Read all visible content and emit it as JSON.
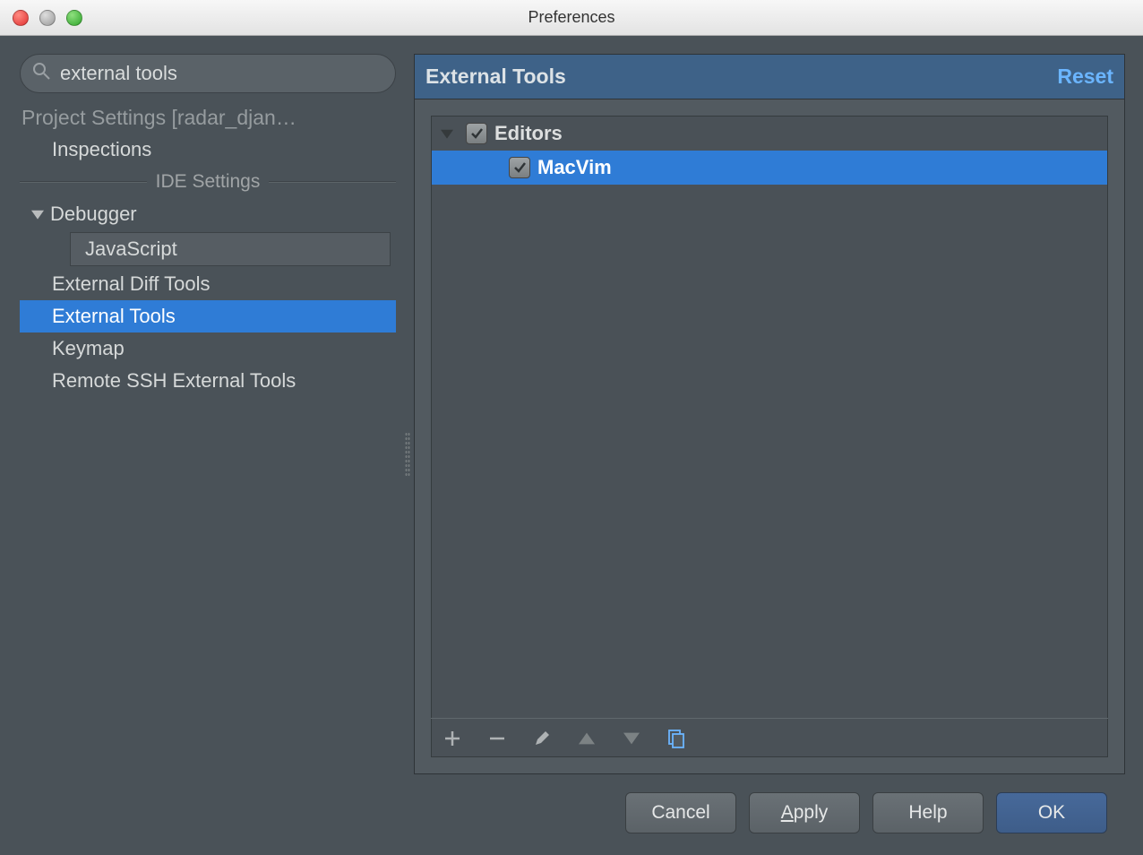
{
  "window": {
    "title": "Preferences"
  },
  "search": {
    "value": "external tools"
  },
  "sidebar": {
    "project_heading": "Project Settings [radar_djan…",
    "items": {
      "inspections": "Inspections",
      "ide_divider": "IDE Settings",
      "debugger": "Debugger",
      "javascript": "JavaScript",
      "ext_diff": "External Diff Tools",
      "ext_tools": "External Tools",
      "keymap": "Keymap",
      "remote_ssh": "Remote SSH External Tools"
    }
  },
  "panel": {
    "title": "External Tools",
    "reset": "Reset",
    "group": "Editors",
    "tool": "MacVim"
  },
  "buttons": {
    "cancel": "Cancel",
    "apply_pre": "A",
    "apply_rest": "pply",
    "help": "Help",
    "ok": "OK"
  }
}
